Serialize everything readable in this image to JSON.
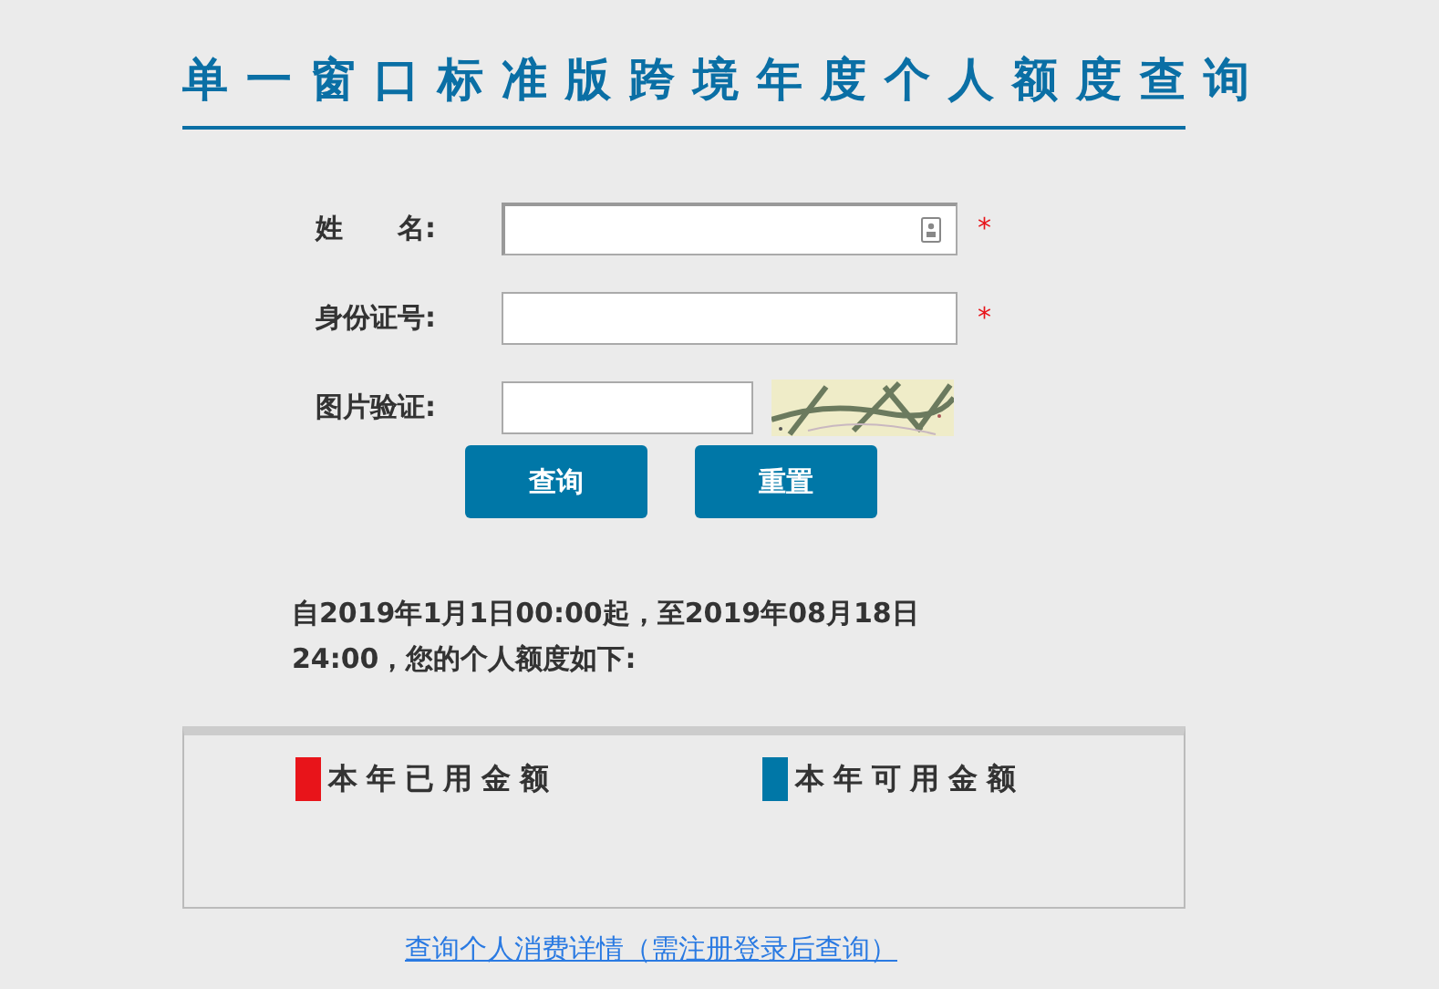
{
  "title": "单一窗口标准版跨境年度个人额度查询",
  "form": {
    "fields": [
      {
        "kind": "name",
        "label": "姓　　名:",
        "required": true,
        "required_mark": "*"
      },
      {
        "kind": "text",
        "label": "身份证号:",
        "required": true,
        "required_mark": "*"
      },
      {
        "kind": "captcha",
        "label": "图片验证:",
        "required": false
      }
    ],
    "buttons": [
      "查询",
      "重置"
    ]
  },
  "period_text": "自2019年1月1日00:00起，至2019年08月18日24:00，您的个人额度如下:",
  "legend": [
    {
      "label": "本年已用金额",
      "color": "#e8141a"
    },
    {
      "label": "本年可用金额",
      "color": "#0077a7"
    }
  ],
  "details_link": "查询个人消费详情（需注册登录后查询）"
}
